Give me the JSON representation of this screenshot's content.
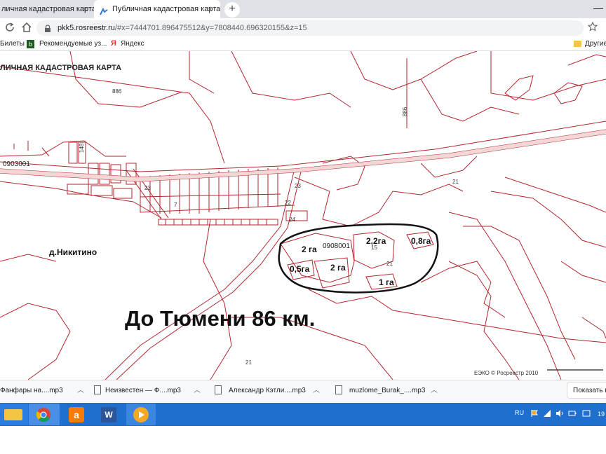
{
  "browser": {
    "tabs": [
      {
        "title": "личная кадастровая карта -",
        "close": "×"
      },
      {
        "title": "Публичная кадастровая карта",
        "close": "×"
      }
    ],
    "new_tab": "+",
    "window_min": "—",
    "url_host": "pkk5.rosreestr.ru",
    "url_path": "/#x=7444701.896475512&y=7808440.696320155&z=15",
    "bookmarks": [
      "Билеты",
      "Рекомендуемые уз...",
      "Яндекс",
      "Другие"
    ]
  },
  "map": {
    "header": "ЛИЧНАЯ КАДАСТРОВАЯ КАРТА",
    "labels": {
      "q886_top": "886",
      "q886_right": "886",
      "q148": "148",
      "q0903001": "0903001",
      "q23": "23",
      "q24": "24",
      "q21a": "21",
      "q21b": "21",
      "q21c": "21",
      "q15": "15",
      "q0908001": "0908001",
      "q7": "7",
      "q22": "22",
      "q23b": "23"
    },
    "lots": [
      "2 га",
      "2,2га",
      "0,8га",
      "0,5га",
      "2 га",
      "1 га"
    ],
    "village": "д.Никитино",
    "distance_note": "До Тюмени 86 км.",
    "copyright": "ЕЭКО © Росреестр 2010",
    "colors": {
      "parcel_line": "#b3262d",
      "road_fill": "#f3d6d6",
      "outline": "#111111"
    }
  },
  "downloads": {
    "items": [
      "Фанфары на....mp3",
      "Неизвестен — Ф....mp3",
      "Александр Кэтли....mp3",
      "muzlome_Burak_....mp3"
    ],
    "show_all": "Показать в"
  },
  "taskbar": {
    "lang": "RU",
    "clock": "19"
  }
}
